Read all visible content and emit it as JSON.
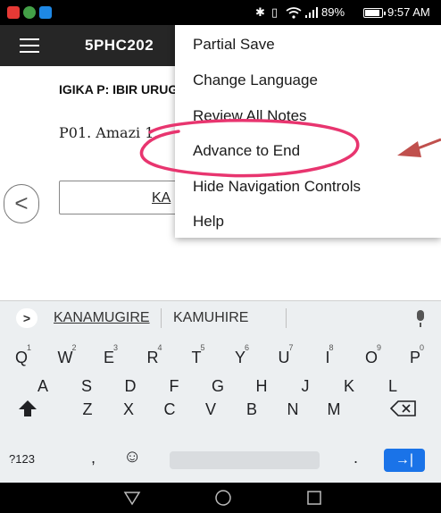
{
  "status_bar": {
    "icons": [
      "app-notification-icon",
      "whatsapp-icon",
      "app-notification-icon",
      "bluetooth-icon",
      "vibrate-icon",
      "wifi-icon",
      "signal-icon",
      "battery-icon"
    ],
    "battery_text": "89%",
    "battery_level": 0.89,
    "time": "9:57 AM"
  },
  "app_bar": {
    "title": "5PHC202",
    "menu_icon": "hamburger-icon"
  },
  "content": {
    "section_title": "IGIKA P: IBIR URUGO",
    "question": "P01. Amazi 1.",
    "answer": "KA",
    "prev_icon": "chevron-left-icon"
  },
  "menu": {
    "items": [
      {
        "label": "Partial Save"
      },
      {
        "label": "Change Language"
      },
      {
        "label": "Review All Notes"
      },
      {
        "label": "Advance to End",
        "highlighted": true
      },
      {
        "label": "Hide Navigation Controls"
      },
      {
        "label": "Help"
      }
    ]
  },
  "annotation": {
    "highlight_color": "#e8356f",
    "arrow_color": "#c0504d"
  },
  "suggestions": {
    "arrow": ">",
    "words": [
      "KANAMUGIRE",
      "KAMUHIRE"
    ],
    "mic_icon": "microphone-icon"
  },
  "keyboard": {
    "row1": [
      {
        "key": "Q",
        "alt": "1"
      },
      {
        "key": "W",
        "alt": "2"
      },
      {
        "key": "E",
        "alt": "3"
      },
      {
        "key": "R",
        "alt": "4"
      },
      {
        "key": "T",
        "alt": "5"
      },
      {
        "key": "Y",
        "alt": "6"
      },
      {
        "key": "U",
        "alt": "7"
      },
      {
        "key": "I",
        "alt": "8"
      },
      {
        "key": "O",
        "alt": "9"
      },
      {
        "key": "P",
        "alt": "0"
      }
    ],
    "row2": [
      "A",
      "S",
      "D",
      "F",
      "G",
      "H",
      "J",
      "K",
      "L"
    ],
    "row3": [
      "Z",
      "X",
      "C",
      "V",
      "B",
      "N",
      "M"
    ],
    "symbols_key": "?123",
    "comma": ",",
    "emoji_key": "☺",
    "period": ".",
    "enter_key": "→|",
    "shift_icon": "shift-icon",
    "backspace_icon": "backspace-icon"
  },
  "nav_bar": {
    "buttons": [
      "back-triangle-icon",
      "home-circle-icon",
      "recents-square-icon"
    ]
  }
}
